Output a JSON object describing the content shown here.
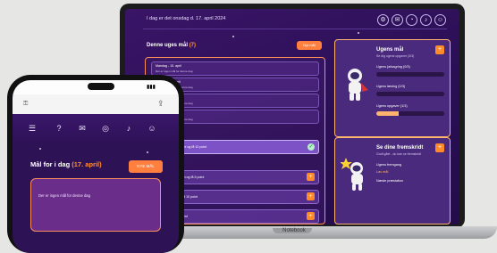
{
  "laptop": {
    "date_text": "I dag er det onsdag d. 17. april 2024",
    "week_title": "Denne uges mål",
    "week_number": "(7)",
    "week_button": "Nyt mål",
    "base_label": "Notebook",
    "days": [
      {
        "title": "Mandag - 15. april",
        "sub": "Der er ingen mål for denne dag"
      },
      {
        "title": "Tirsdag - 16. april",
        "sub": "Der er ingen mål for denne dag"
      },
      {
        "title": "Onsdag - 17. april",
        "sub": "Der er ingen mål for denne dag"
      },
      {
        "title": "Torsdag - 18. april",
        "sub": "Der er ingen mål for denne dag"
      }
    ],
    "done_task": "Fuldfør første opgave og få 10 point",
    "tasks": [
      "Læs 10 sider i bogen og få 5 point",
      "Lav dine lektier og få 10 point",
      "Gå en tur og få 5 point"
    ],
    "goals_card": {
      "title": "Ugens mål",
      "sub": "Se dig ugens opgaver (3/3)",
      "items": [
        {
          "label": "Ugens (afsagring (0/3)",
          "value": 0
        },
        {
          "label": "Ugens læsing (0/3)",
          "value": 0
        },
        {
          "label": "Ugens opgaver (1/3)",
          "value": 0.33
        }
      ]
    },
    "progress_card": {
      "title": "Se dine fremskridt",
      "sub": "Godt gået - du kan se fremskridt",
      "items": [
        {
          "label": "Ugens fremgang",
          "color": "#ffffff"
        },
        {
          "label": "Lav mål",
          "color": "#ffb56e"
        },
        {
          "label": "Næste præstation",
          "color": "#ffffff"
        }
      ]
    },
    "icons": [
      "gear-icon",
      "mail-icon",
      "chart-icon",
      "bell-icon",
      "user-icon"
    ]
  },
  "phone": {
    "time": "",
    "title": "Mål for i dag",
    "date": "(17. april)",
    "button": "NYE MÅL",
    "empty_text": "Der er ingen mål for denne dag",
    "nav_icons": [
      "menu-icon",
      "help-icon",
      "mail-icon",
      "target-icon",
      "bell-icon",
      "user-icon"
    ]
  },
  "colors": {
    "accent": "#ff7f3f",
    "background": "#2e1256"
  }
}
